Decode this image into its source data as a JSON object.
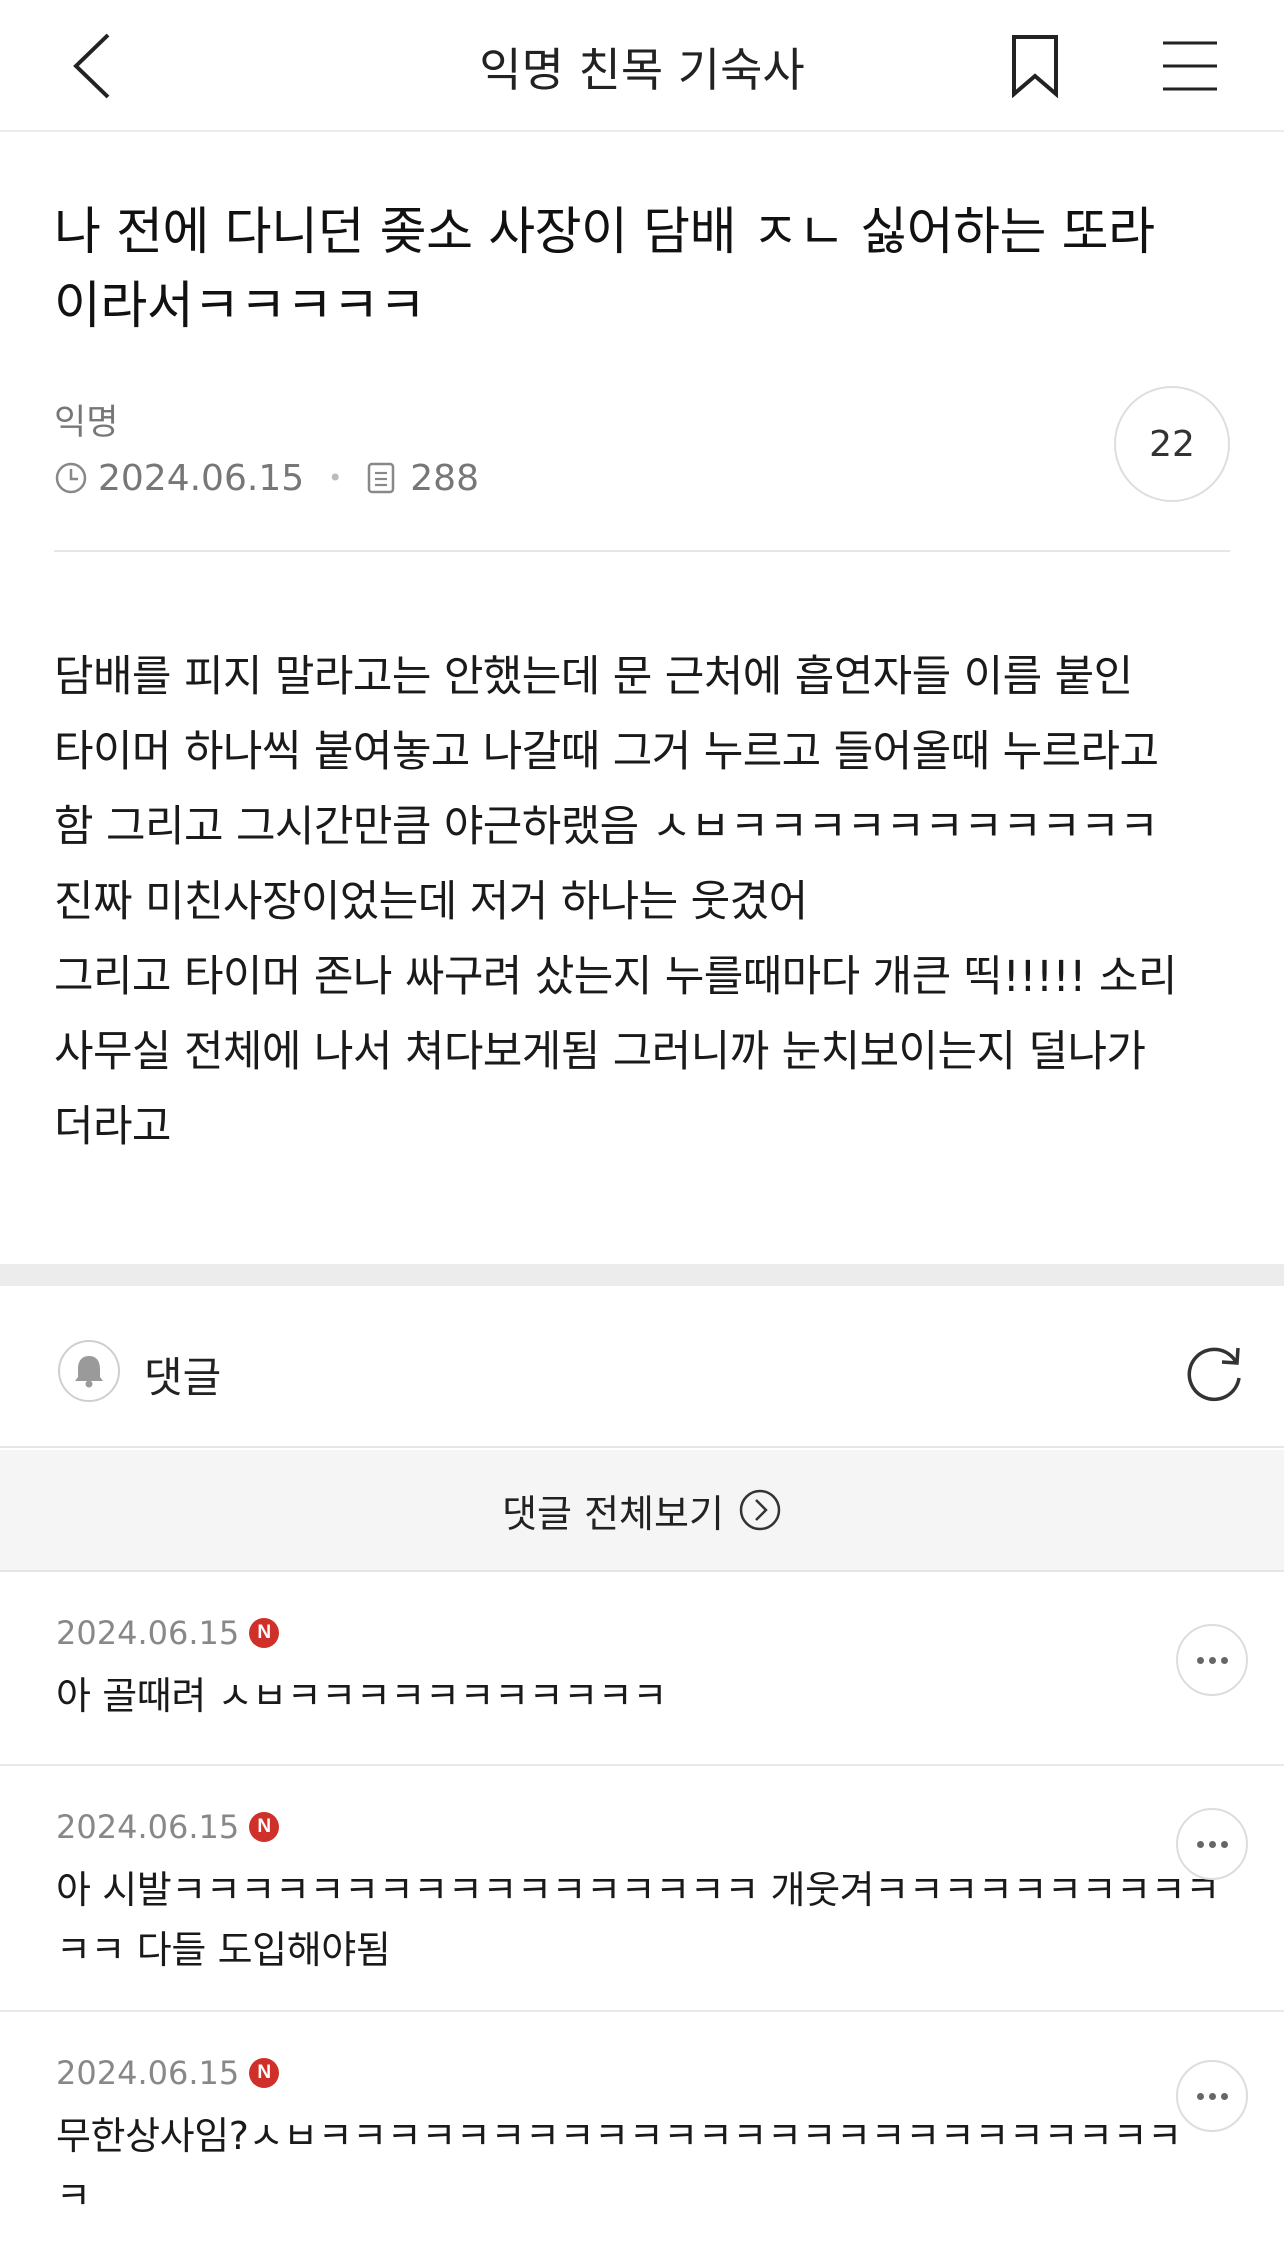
{
  "header": {
    "back_icon": "chevron-left-icon",
    "title": "익명 친목 기숙사",
    "bookmark_icon": "bookmark-icon",
    "menu_icon": "hamburger-menu-icon"
  },
  "post": {
    "title_lines": [
      "나 전에 다니던 좆소 사장이 담배 ㅈㄴ 싫어하는 또라",
      "이라서ㅋㅋㅋㅋㅋ"
    ],
    "author": "익명",
    "date": "2024.06.15",
    "views": "288",
    "comment_count": "22",
    "body_lines": [
      "담배를 피지 말라고는 안했는데 문 근처에 흡연자들 이름 붙인",
      "타이머 하나씩 붙여놓고 나갈때 그거 누르고 들어올때 누르라고",
      "함 그리고 그시간만큼 야근하랬음 ㅅㅂㅋㅋㅋㅋㅋㅋㅋㅋㅋㅋㅋ",
      "진짜 미친사장이었는데 저거 하나는 웃겼어",
      "그리고 타이머 존나 싸구려 샀는지 누를때마다 개큰 띡!!!!! 소리",
      "사무실 전체에 나서 쳐다보게됨 그러니까 눈치보이는지 덜나가",
      "더라고"
    ]
  },
  "comments_section": {
    "label": "댓글",
    "view_all": "댓글 전체보기",
    "badge_text": "N",
    "items": [
      {
        "date": "2024.06.15",
        "lines": [
          "아 골때려 ㅅㅂㅋㅋㅋㅋㅋㅋㅋㅋㅋㅋㅋ"
        ]
      },
      {
        "date": "2024.06.15",
        "lines": [
          "아 시발ㅋㅋㅋㅋㅋㅋㅋㅋㅋㅋㅋㅋㅋㅋㅋㅋㅋ 개웃겨ㅋㅋㅋㅋㅋㅋㅋㅋㅋㅋ",
          "ㅋㅋ 다들 도입해야됨"
        ]
      },
      {
        "date": "2024.06.15",
        "lines": [
          "무한상사임?ㅅㅂㅋㅋㅋㅋㅋㅋㅋㅋㅋㅋㅋㅋㅋㅋㅋㅋㅋㅋㅋㅋㅋㅋㅋㅋㅋ",
          "ㅋ"
        ]
      }
    ]
  },
  "colors": {
    "accent_badge": "#d0302a",
    "divider": "#e6e6e6",
    "band": "#ececec"
  }
}
